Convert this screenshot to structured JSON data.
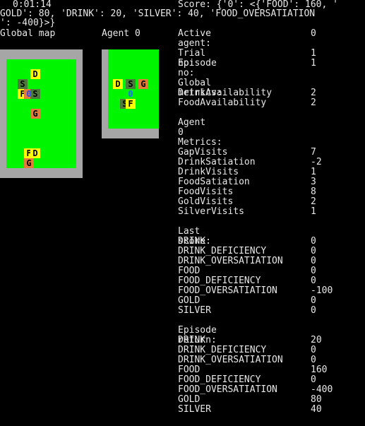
{
  "header": {
    "clock": "0:01:14",
    "score_line_1": "Score: {'0': <{'FOOD': 160, '",
    "score_line_2": "GOLD': 80, 'DRINK': 20, 'SILVER': 40, 'FOOD_OVERSATIATION",
    "score_line_3": "': -400}>}"
  },
  "maps": {
    "global_title": "Global map",
    "agent_title": "Agent 0",
    "global_cells": [
      {
        "glyph": "D",
        "kind": "drink"
      },
      {
        "glyph": "S",
        "kind": "silver"
      },
      {
        "glyph": "F",
        "kind": "food"
      },
      {
        "glyph": "0",
        "kind": "agent"
      },
      {
        "glyph": "S",
        "kind": "silver"
      },
      {
        "glyph": "G",
        "kind": "gold"
      },
      {
        "glyph": "F",
        "kind": "food"
      },
      {
        "glyph": "D",
        "kind": "drink"
      },
      {
        "glyph": "G",
        "kind": "gold"
      }
    ],
    "agent_cells": [
      {
        "glyph": "D",
        "kind": "drink"
      },
      {
        "glyph": "S",
        "kind": "silver"
      },
      {
        "glyph": "G",
        "kind": "gold"
      },
      {
        "glyph": "0",
        "kind": "agent"
      },
      {
        "glyph": "S",
        "kind": "silver"
      },
      {
        "glyph": "F",
        "kind": "food"
      }
    ]
  },
  "colors": {
    "background": "#000000",
    "wall": "#a6a6a6",
    "floor": "#00f500",
    "food": "#ffff00",
    "drink": "#ffff00",
    "gold": "#e07b39",
    "silver": "#4d7a3a",
    "agent": "#e07b39",
    "agent_text": "#2244ff",
    "agent_view_text": "#2266ff"
  },
  "info": {
    "active_agent": {
      "label": "Active agent:",
      "value": "0"
    },
    "trial": {
      "label": "Trial no:",
      "value": "1"
    },
    "episode": {
      "label": "Episode no:",
      "value": "1"
    },
    "global_metrics_title": "Global metrics:",
    "global_metrics": [
      {
        "label": "DrinkAvailability",
        "value": "2"
      },
      {
        "label": "FoodAvailability",
        "value": "2"
      }
    ],
    "agent_title": "Agent 0",
    "metrics_title": "Metrics:",
    "metrics": [
      {
        "label": "GapVisits",
        "value": "7"
      },
      {
        "label": "DrinkSatiation",
        "value": "-2"
      },
      {
        "label": "DrinkVisits",
        "value": "1"
      },
      {
        "label": "FoodSatiation",
        "value": "3"
      },
      {
        "label": "FoodVisits",
        "value": "8"
      },
      {
        "label": "GoldVisits",
        "value": "2"
      },
      {
        "label": "SilverVisits",
        "value": "1"
      }
    ],
    "last_score_title": "Last score:",
    "last_score": [
      {
        "label": "DRINK",
        "value": "0"
      },
      {
        "label": "DRINK_DEFICIENCY",
        "value": "0"
      },
      {
        "label": "DRINK_OVERSATIATION",
        "value": "0"
      },
      {
        "label": "FOOD",
        "value": "0"
      },
      {
        "label": "FOOD_DEFICIENCY",
        "value": "0"
      },
      {
        "label": "FOOD_OVERSATIATION",
        "value": "-100"
      },
      {
        "label": "GOLD",
        "value": "0"
      },
      {
        "label": "SILVER",
        "value": "0"
      }
    ],
    "episode_return_title": "Episode return:",
    "episode_return": [
      {
        "label": "DRINK",
        "value": "20"
      },
      {
        "label": "DRINK_DEFICIENCY",
        "value": "0"
      },
      {
        "label": "DRINK_OVERSATIATION",
        "value": "0"
      },
      {
        "label": "FOOD",
        "value": "160"
      },
      {
        "label": "FOOD_DEFICIENCY",
        "value": "0"
      },
      {
        "label": "FOOD_OVERSATIATION",
        "value": "-400"
      },
      {
        "label": "GOLD",
        "value": "80"
      },
      {
        "label": "SILVER",
        "value": "40"
      }
    ]
  }
}
